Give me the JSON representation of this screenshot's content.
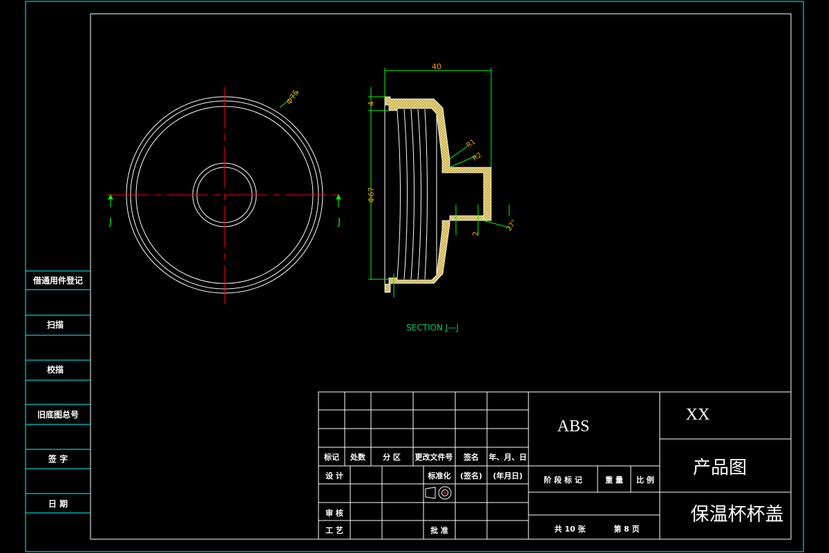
{
  "drawing": {
    "section_label": "SECTION J—J",
    "cut_marks": [
      "J",
      "J"
    ],
    "dims": {
      "od": "Φ75",
      "width": "40",
      "wall": "4",
      "inner_d": "Φ67",
      "r1": "R1",
      "r2": "R2",
      "step": "2",
      "angle": "27°"
    }
  },
  "left_panel": {
    "rows": [
      "借通用件登记",
      "扫描",
      "校描",
      "旧底图总号",
      "签 字",
      "日 期"
    ]
  },
  "title_block": {
    "material": "ABS",
    "company": "XX",
    "drawing_type": "产品图",
    "part_name": "保温杯杯盖",
    "revision_headers": [
      "标记",
      "处数",
      "分 区",
      "更改文件号",
      "签名",
      "年、月、日"
    ],
    "design": "设 计",
    "standardize": "标准化",
    "signature_hint": "(签名)",
    "date_hint": "(年月日)",
    "review": "审 核",
    "process": "工 艺",
    "approve": "批 准",
    "stage_mark": "阶 段 标 记",
    "weight": "重 量",
    "scale": "比 例",
    "sheets_total": "共 10 张",
    "sheet_no": "第 8 页"
  },
  "colors": {
    "frame": "#00ffff",
    "inner_frame": "#ffffff",
    "centerline": "#ff0000",
    "dimension": "#00ff00",
    "dim_text": "#ff9900",
    "hatch": "#ffff66",
    "section_text": "#00cc66"
  }
}
